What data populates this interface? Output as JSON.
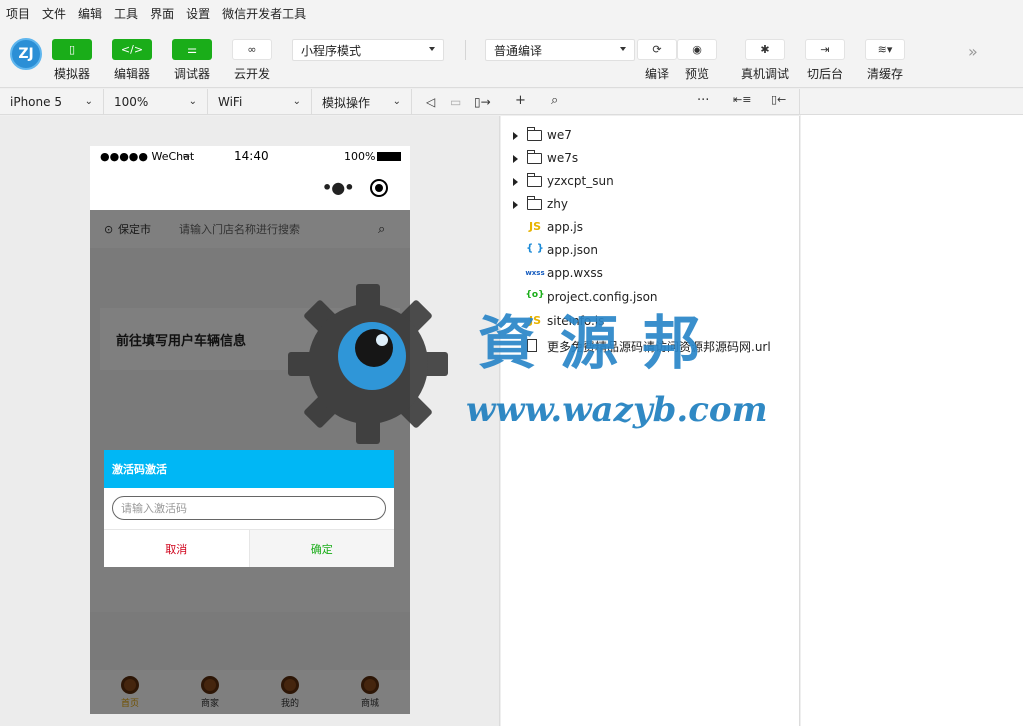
{
  "menu": [
    "项目",
    "文件",
    "编辑",
    "工具",
    "界面",
    "设置",
    "微信开发者工具"
  ],
  "toolbar": {
    "logo": "ZJ",
    "simulator": "模拟器",
    "editor": "编辑器",
    "debugger": "调试器",
    "cloud": "云开发",
    "mode_select": "小程序模式",
    "compile_select": "普通编译",
    "compile": "编译",
    "preview": "预览",
    "remote_debug": "真机调试",
    "background": "切后台",
    "clear_cache": "清缓存",
    "more": "»"
  },
  "subbar": {
    "device": "iPhone 5",
    "zoom": "100%",
    "network": "WiFi",
    "operation": "模拟操作"
  },
  "phone": {
    "signal": "●●●●● WeChat",
    "time": "14:40",
    "battery": "100%",
    "location": "保定市",
    "search_placeholder": "请输入门店名称进行搜索",
    "card_text": "前往填写用户车辆信息",
    "dialog": {
      "title": "激活码激活",
      "input_placeholder": "请输入激活码",
      "cancel": "取消",
      "confirm": "确定"
    },
    "tabs": [
      "首页",
      "商家",
      "我的",
      "商城"
    ]
  },
  "files": [
    {
      "type": "folder",
      "name": "we7"
    },
    {
      "type": "folder",
      "name": "we7s"
    },
    {
      "type": "folder",
      "name": "yzxcpt_sun"
    },
    {
      "type": "folder",
      "name": "zhy"
    },
    {
      "type": "js",
      "icon": "JS",
      "name": "app.js"
    },
    {
      "type": "json",
      "icon": "{ }",
      "name": "app.json"
    },
    {
      "type": "wxss",
      "icon": "wxss",
      "name": "app.wxss"
    },
    {
      "type": "cfg",
      "icon": "{o}",
      "name": "project.config.json"
    },
    {
      "type": "js",
      "icon": "JS",
      "name": "siteinfo.js"
    },
    {
      "type": "doc",
      "icon": "",
      "name": "更多免费精品源码请访问资源邦源码网.url"
    }
  ],
  "watermark": {
    "text": "資源邦",
    "url": "www.wazyb.com"
  },
  "colors": {
    "green": "#1aad19",
    "dialog_head": "#00b7f5",
    "watermark": "#2a86c8"
  }
}
